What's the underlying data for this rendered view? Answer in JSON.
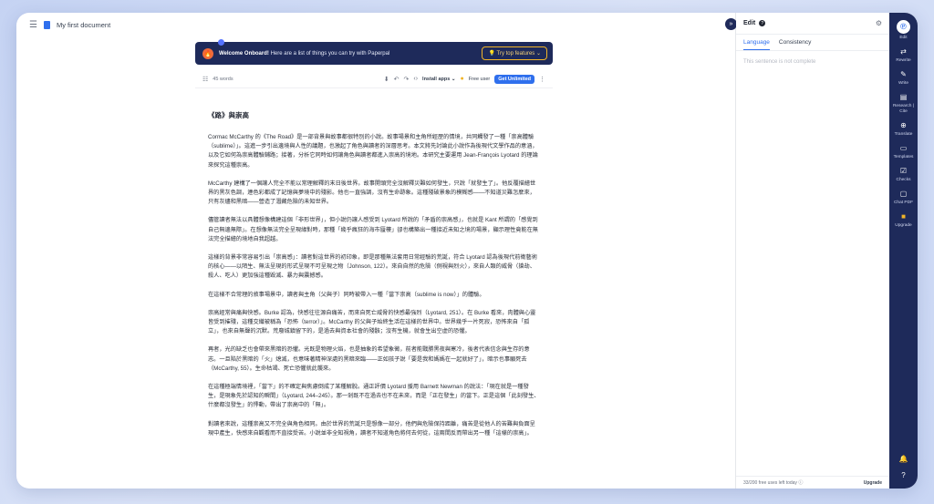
{
  "topbar": {
    "menu_icon": "hamburger-icon",
    "doc_icon": "document-icon",
    "title": "My first document"
  },
  "banner": {
    "icon": "flame-icon",
    "lead": "Welcome Onboard!",
    "text": " Here are a list of things you can try with Paperpal",
    "cta": "Try top features ⌄"
  },
  "toolbar": {
    "word_count": "45 words",
    "install": "Install apps ⌄",
    "free": "Free user",
    "get_unlimited": "Get Unlimited"
  },
  "document": {
    "heading": "《路》與崇高",
    "paragraphs": [
      "Cormac McCarthy 的《The Road》是一部背景與故事都很特別的小說。故事場景和主角所經歷的情境，共同觸發了一種「崇高體驗（sublime）」。這進一步引出邊境與人性的議題，也激起了角色與讀者的深層思考。本文將先討論此小說作為後現代文學作品的意涵，以及它如何為崇高體驗鋪路；接著，分析它同時如何讓角色與讀者都進入崇高的境地。本研究主要運用 Jean-François Lyotard 的理論來探究這種崇高。",
      "McCarthy 建構了一個讓人完全不能以常理解釋的末日後世界。故事開頭完全沒解釋災難如何發生，只說「就發生了」。他反覆描繪世界的黑灰色調，連色彩都成了記憶與夢境中的殘影。他也一直強調，沒有生命跡象。這種殘破景象的模糊感——不知道災難怎麼來，只有灰燼和黑暗——營造了潛藏危險的未知世界。",
      "儘管讀者無法以具體想像構建這個「非形世界」，但小說仍讓人感受到 Lyotard 所說的「矛盾的崇高感」，也就是 Kant 所謂的「感覺到自己無邊無際」。在想像無法完全呈現緣對時，那種「幾乎瘋狂的海市蜃樓」卻也構築出一種接近未知之境的場景，顯示理性竟能在無法完全描繪的境地自我超越。",
      "這樣的背景非常容易引出「崇高感」：讀者對這世界的初印象，即是那種無法套用日常經驗的荒誕，符合 Lyotard 認為後現代前衛藝術的核心——以陌生、無法呈現的形式呈現不可呈現之物（Johnson, 122）。來自自然的危險（側視與烈火），來自人類的威脅（搶劫、殺人、吃人）更加強這種毀滅、暴力與震撼感。",
      "在這樣不合常理的敘事場景中，讀者與主角（父與子）同時被帶入一種「當下崇高（sublime is now）」的體驗。",
      "崇高經常與痛與快感。Burke 認為，快感往往源自痛苦，而來自死亡威脅的快感最強烈（Lyotard, 251）。在 Burke 看來，肉體與心靈皆受到摧殘，這種交織被稱為「恐怖（terror）」。McCarthy 的父與子始終生活在這樣的世界中。世界幾乎一片死寂，恐怖來自「孤立」，也來自無聲的沉默。荒廢城鎮留下的，是過去與資本社會的殘骸；沒有生機，就會生出空虛的恐懼。",
      "再者，光的缺乏也會帶來黑暗的恐懼。光既是物理火焰，也是抽象的希望象徵，前者能戰勝黑夜與寒冷，後者代表信念與生存的意志。一旦陷於黑暗的「火」熄滅，也意味著精神深處的黑暗來臨——正如孩子說「要是我和媽媽在一起就好了」，暗示也事願死去（McCarthy, 55）。生命枯竭、死亡恐懼就此襲來。",
      "在這種極端情境裡，「當下」的不確定與焦慮倒成了某種解脫。通正評價 Lyotard 援用 Barnett Newman 的說法：「現在就是一種發生，是現象先於認知的瞬間」（Lyotard, 244–245）。那一剎既不在過去也不在未來，而是「正在發生」的當下。正是這個「此刻發生、什麼都沒發生」的悸動，帶出了崇高中的「無」。",
      "對讀者來說，這種崇高又不完全與角色相同。由於世界的荒誕只是想像一部分，他們與危險保持距離，痛苦是從他人的苦難與負面呈現中產生，快感來自觀看而不直接受苦。小說並非全知視角，讀者不知道角色將何去何從，這兩間反而帶出另一種「這樣的崇高」。"
    ]
  },
  "edit_panel": {
    "title": "Edit",
    "help_icon": "help-icon",
    "settings_icon": "sliders-icon",
    "tabs": [
      "Language",
      "Consistency"
    ],
    "placeholder": "This sentence is not complete",
    "footer_left": "33/200 free uses left today ⓘ",
    "footer_right": "Upgrade"
  },
  "rail": {
    "items": [
      {
        "icon": "paperpal-logo",
        "label": "Edit"
      },
      {
        "icon": "rewrite-icon",
        "label": "Rewrite"
      },
      {
        "icon": "write-icon",
        "label": "Write"
      },
      {
        "icon": "research-icon",
        "label": "Research | Cite"
      },
      {
        "icon": "translate-icon",
        "label": "Translate"
      },
      {
        "icon": "templates-icon",
        "label": "Templates"
      },
      {
        "icon": "checks-icon",
        "label": "Checks"
      },
      {
        "icon": "chat-pdf-icon",
        "label": "Chat PDF"
      },
      {
        "icon": "upgrade-icon",
        "label": "Upgrade"
      }
    ],
    "bottom": [
      "bell-icon",
      "help-icon"
    ]
  },
  "colors": {
    "accent": "#2f6fed",
    "navy": "#1e2a5a",
    "gold": "#f0b429"
  }
}
